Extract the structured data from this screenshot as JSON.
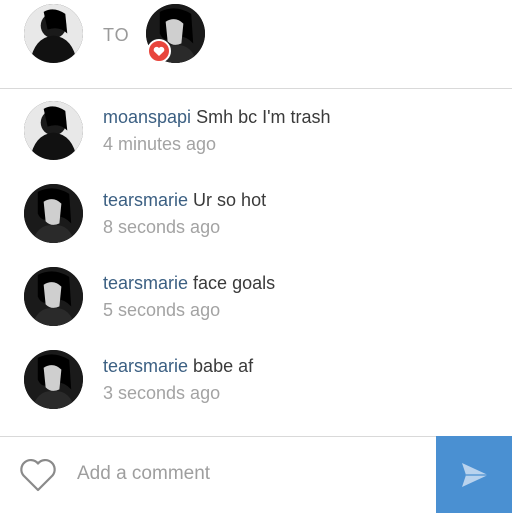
{
  "header": {
    "to_label": "TO",
    "badge_icon": "heart-icon",
    "badge_color": "#e8453c"
  },
  "comments": [
    {
      "username": "moanspapi",
      "text": "Smh bc I'm trash",
      "time": "4 minutes ago"
    },
    {
      "username": "tearsmarie",
      "text": "Ur so hot",
      "time": "8 seconds ago"
    },
    {
      "username": "tearsmarie",
      "text": "face goals",
      "time": "5 seconds ago"
    },
    {
      "username": "tearsmarie",
      "text": "babe af",
      "time": "3 seconds ago"
    }
  ],
  "footer": {
    "input_placeholder": "Add a comment",
    "like_icon": "heart-outline-icon",
    "send_icon": "send-icon",
    "send_color": "#4a90d2"
  },
  "colors": {
    "username": "#3b5f82",
    "timestamp": "#a3a3a3",
    "divider": "#d9d9d9"
  }
}
